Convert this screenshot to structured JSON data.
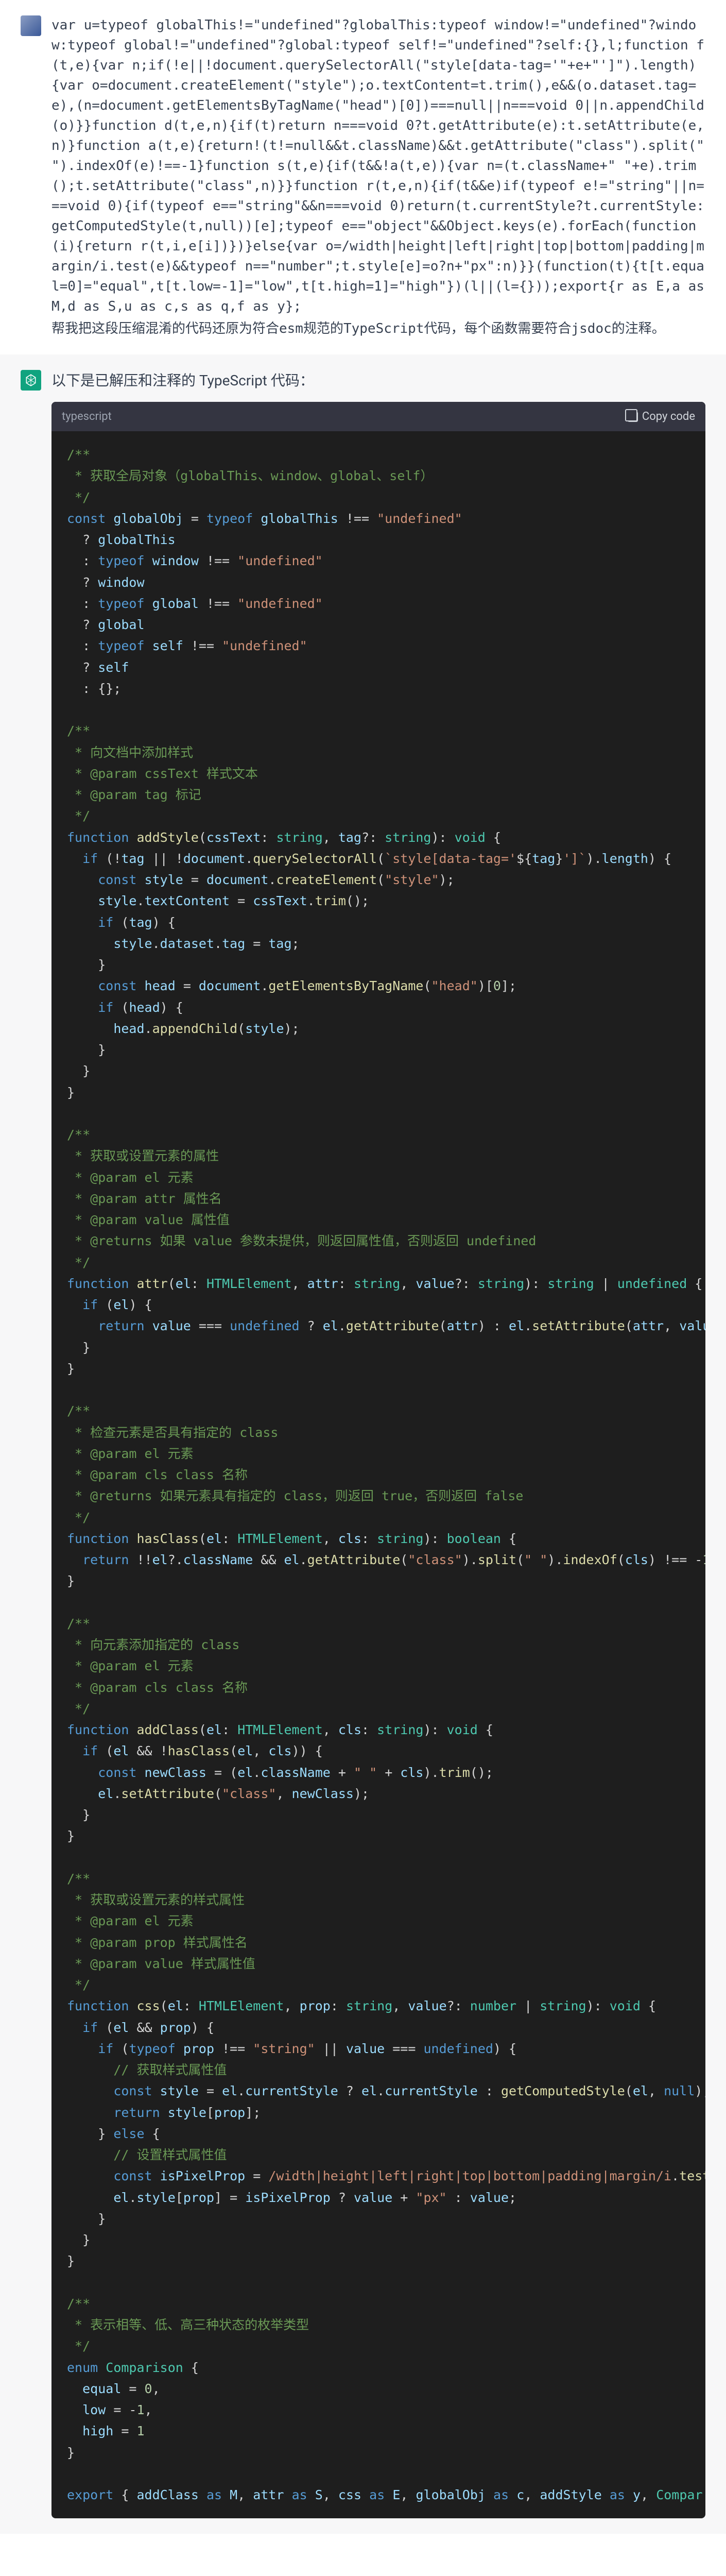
{
  "user_msg": {
    "code": "var u=typeof globalThis!=\"undefined\"?globalThis:typeof window!=\"undefined\"?window:typeof global!=\"undefined\"?global:typeof self!=\"undefined\"?self:{},l;function f(t,e){var n;if(!e||!document.querySelectorAll(\"style[data-tag='\"+e+\"']\").length){var o=document.createElement(\"style\");o.textContent=t.trim(),e&&(o.dataset.tag=e),(n=document.getElementsByTagName(\"head\")[0])===null||n===void 0||n.appendChild(o)}}function d(t,e,n){if(t)return n===void 0?t.getAttribute(e):t.setAttribute(e,n)}function a(t,e){return!(t!=null&&t.className)&&t.getAttribute(\"class\").split(\" \").indexOf(e)!==-1}function s(t,e){if(t&&!a(t,e)){var n=(t.className+\" \"+e).trim();t.setAttribute(\"class\",n)}}function r(t,e,n){if(t&&e)if(typeof e!=\"string\"||n===void 0){if(typeof e==\"string\"&&n===void 0)return(t.currentStyle?t.currentStyle:getComputedStyle(t,null))[e];typeof e==\"object\"&&Object.keys(e).forEach(function(i){return r(t,i,e[i])})}else{var o=/width|height|left|right|top|bottom|padding|margin/i.test(e)&&typeof n==\"number\";t.style[e]=o?n+\"px\":n)}}(function(t){t[t.equal=0]=\"equal\",t[t.low=-1]=\"low\",t[t.high=1]=\"high\"})(l||(l={}));export{r as E,a as M,d as S,u as c,s as q,f as y};",
    "instruction": "帮我把这段压缩混淆的代码还原为符合esm规范的TypeScript代码，每个函数需要符合jsdoc的注释。"
  },
  "assistant": {
    "intro": "以下是已解压和注释的 TypeScript 代码：",
    "code_header": {
      "lang": "typescript",
      "copy": "Copy code"
    }
  }
}
